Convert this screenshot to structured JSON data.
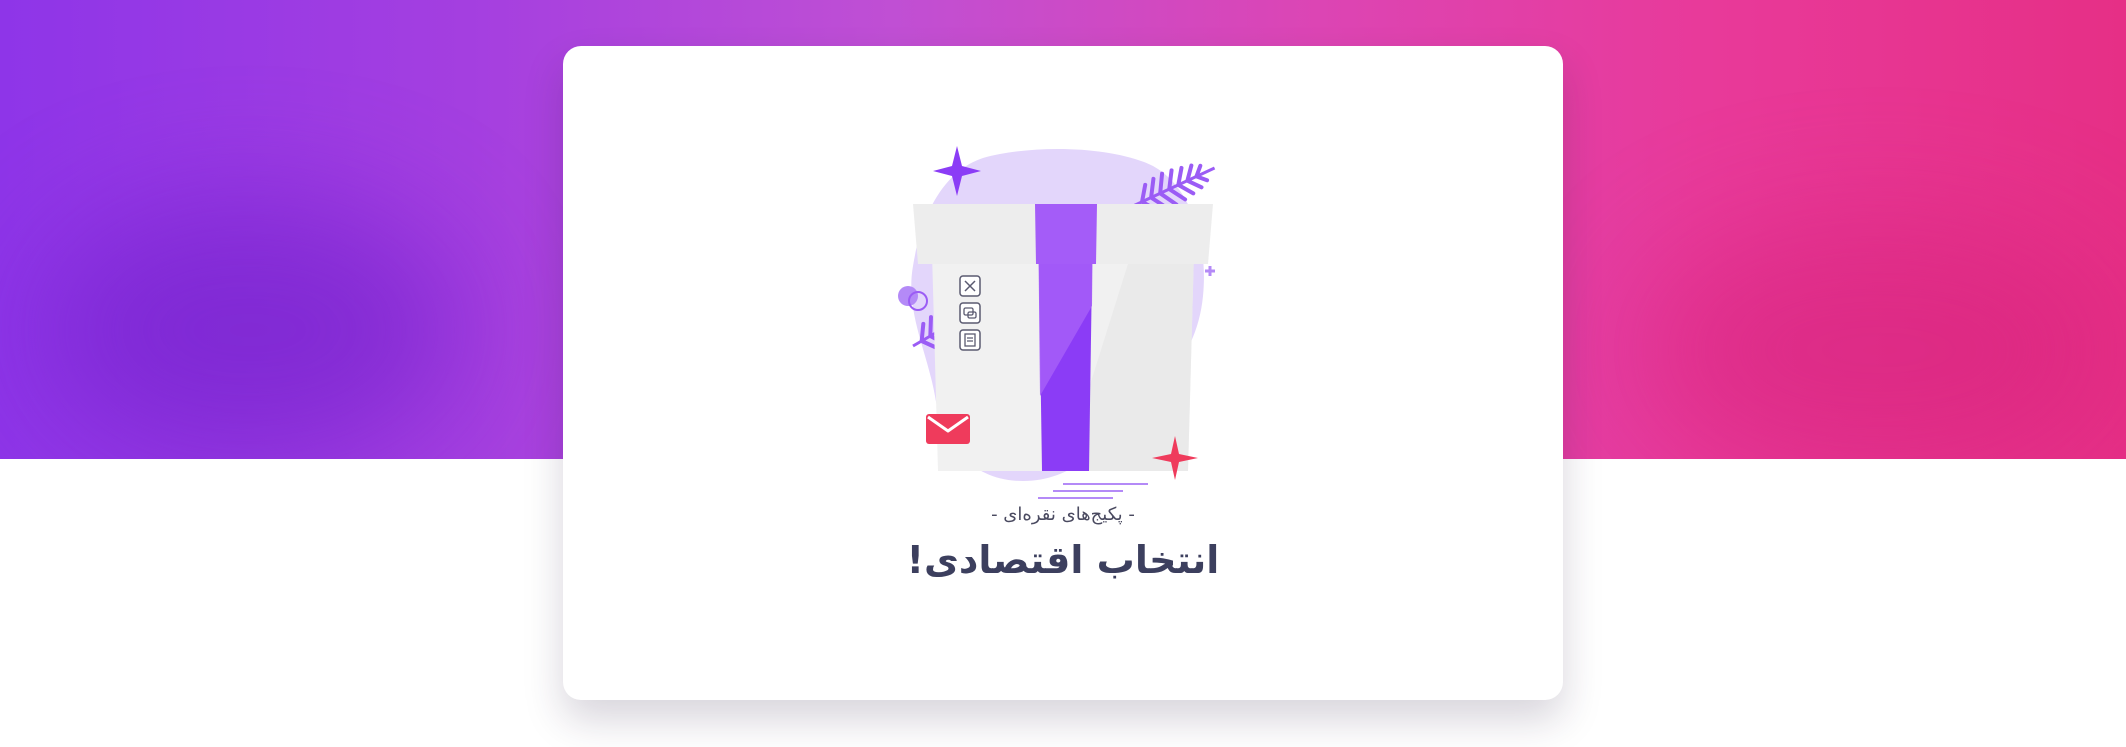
{
  "hero": {
    "gradient_start": "#8e35e8",
    "gradient_end": "#e62f86"
  },
  "card": {
    "subtitle": "- پکیج‌های نقره‌ای -",
    "title": "انتخاب اقتصادی!"
  },
  "illustration": {
    "icons": [
      "gift-box-icon",
      "envelope-icon",
      "sparkle-icon",
      "leaf-icon",
      "scissors-icon",
      "chat-icon",
      "document-icon"
    ],
    "colors": {
      "purple": "#8b3cf6",
      "light_purple": "#e3d6fb",
      "red": "#ef3b5c",
      "box": "#f1f1f1"
    }
  }
}
